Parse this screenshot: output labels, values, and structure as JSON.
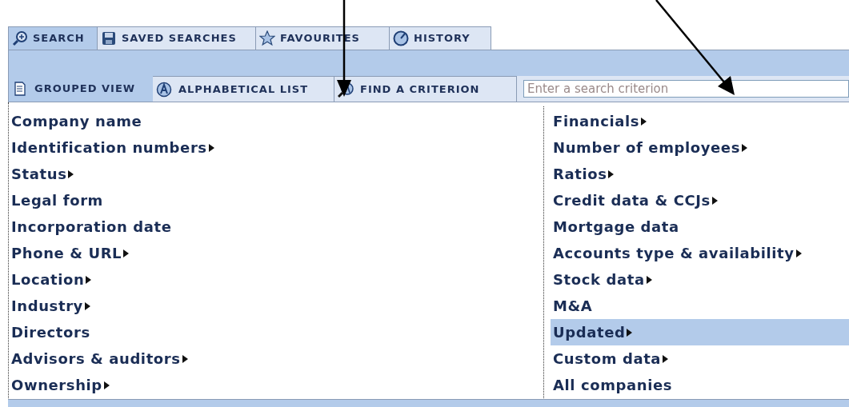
{
  "main_tabs": [
    {
      "label": "SEARCH",
      "selected": true
    },
    {
      "label": "SAVED SEARCHES",
      "selected": false
    },
    {
      "label": "FAVOURITES",
      "selected": false
    },
    {
      "label": "HISTORY",
      "selected": false
    }
  ],
  "view_tabs": [
    {
      "label": "GROUPED VIEW",
      "selected": true
    },
    {
      "label": "ALPHABETICAL LIST",
      "selected": false
    },
    {
      "label": "FIND A CRITERION",
      "selected": false
    }
  ],
  "search": {
    "placeholder": "Enter a search criterion"
  },
  "columns": [
    {
      "items": [
        {
          "label": "Company name",
          "submenu": false,
          "selected": false
        },
        {
          "label": "Identification numbers",
          "submenu": true,
          "selected": false
        },
        {
          "label": "Status",
          "submenu": true,
          "selected": false
        },
        {
          "label": "Legal form",
          "submenu": false,
          "selected": false
        },
        {
          "label": "Incorporation date",
          "submenu": false,
          "selected": false
        },
        {
          "label": "Phone & URL",
          "submenu": true,
          "selected": false
        },
        {
          "label": "Location",
          "submenu": true,
          "selected": false
        },
        {
          "label": "Industry",
          "submenu": true,
          "selected": false
        },
        {
          "label": "Directors",
          "submenu": false,
          "selected": false
        },
        {
          "label": "Advisors & auditors",
          "submenu": true,
          "selected": false
        },
        {
          "label": "Ownership",
          "submenu": true,
          "selected": false
        }
      ]
    },
    {
      "items": [
        {
          "label": "Financials",
          "submenu": true,
          "selected": false
        },
        {
          "label": "Number of employees",
          "submenu": true,
          "selected": false
        },
        {
          "label": "Ratios",
          "submenu": true,
          "selected": false
        },
        {
          "label": "Credit data & CCJs",
          "submenu": true,
          "selected": false
        },
        {
          "label": "Mortgage data",
          "submenu": false,
          "selected": false
        },
        {
          "label": "Accounts type & availability",
          "submenu": true,
          "selected": false
        },
        {
          "label": "Stock data",
          "submenu": true,
          "selected": false
        },
        {
          "label": "M&A",
          "submenu": false,
          "selected": false
        },
        {
          "label": "Updated",
          "submenu": true,
          "selected": true
        },
        {
          "label": "Custom data",
          "submenu": true,
          "selected": false
        },
        {
          "label": "All companies",
          "submenu": false,
          "selected": false
        }
      ]
    }
  ]
}
